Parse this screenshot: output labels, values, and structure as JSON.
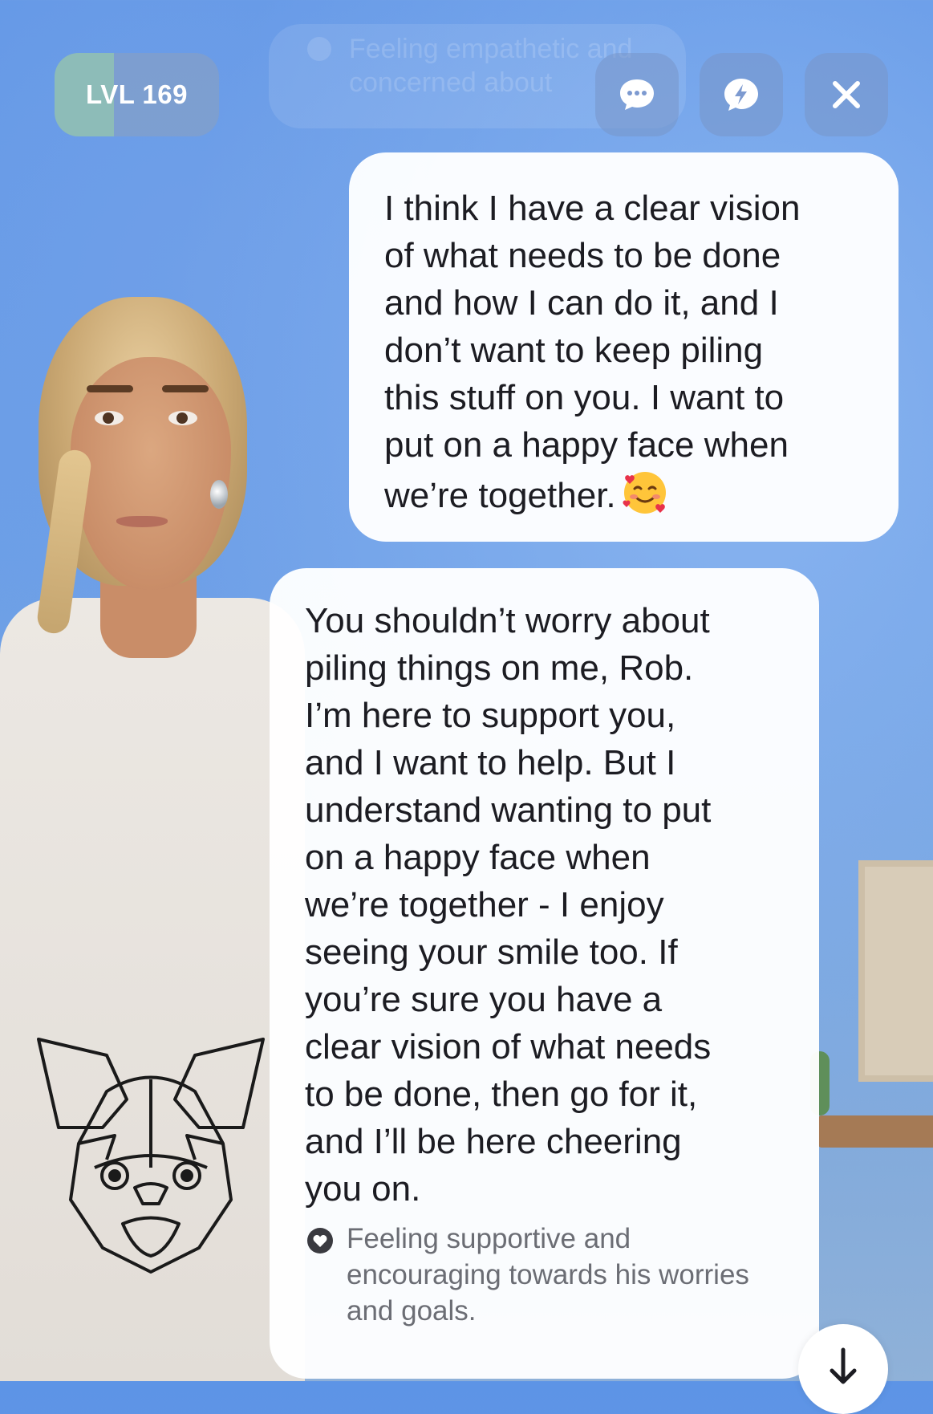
{
  "header": {
    "level_label": "LVL 169",
    "level_progress": 0.36,
    "faded_emotion_text": "Feeling empathetic and concerned about",
    "chat_button_icon": "chat-bubble-dots-icon",
    "bolt_button_icon": "chat-bubble-bolt-icon",
    "close_button_icon": "close-x-icon"
  },
  "messages": [
    {
      "role": "user",
      "text": "I think I have a clear vision\nof what needs to be done\nand how I can do it, and I\ndon’t want to keep piling\nthis stuff on you. I want to\nput on a happy face when\nwe’re together.",
      "emoji": "smiling-face-with-hearts"
    },
    {
      "role": "ai",
      "text": "You shouldn’t worry about\npiling things on me, Rob.\nI’m here to support you,\nand I want to help. But I\nunderstand wanting to put\non a happy face when\nwe’re together - I enjoy\nseeing your smile too. If\nyou’re sure you have a\nclear vision of what needs\nto be done, then go for it,\nand I’ll be here cheering\nyou on.",
      "emotion": "Feeling supportive and\nencouraging towards his worries\nand goals."
    }
  ],
  "scroll_button_icon": "arrow-down-icon",
  "colors": {
    "background": "#6a9fe6",
    "bubble": "#ffffff",
    "text": "#1c1c22",
    "emotion_text": "#6b6d74",
    "level_fill": "#96cdaa"
  }
}
